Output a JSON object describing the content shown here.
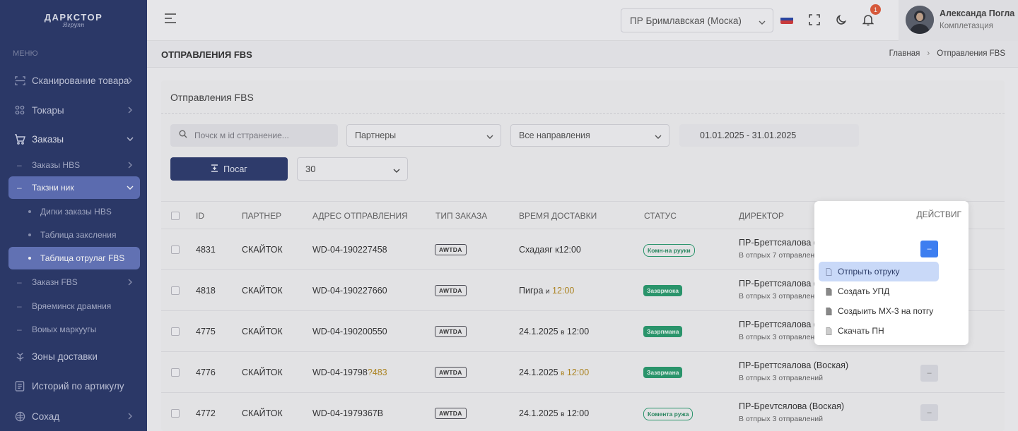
{
  "sidebar": {
    "logo_title": "ДАРКСТОР",
    "logo_sign": "Ягрупп",
    "menu_caption": "МЕНЮ",
    "items": [
      {
        "label": "Сканирование товара",
        "icon": "scan-icon"
      },
      {
        "label": "Токары",
        "icon": "grid-icon"
      },
      {
        "label": "Заказы",
        "icon": "cart-icon"
      },
      {
        "label": "Заказы HBS"
      },
      {
        "label": "Такзни ник"
      },
      {
        "label": "Дигки заказы HBS"
      },
      {
        "label": "Таблица заксления"
      },
      {
        "label": "Таблица отрулаг FBS"
      },
      {
        "label": "Заказн FBS"
      },
      {
        "label": "Вряеминск драмния"
      },
      {
        "label": "Воиых маркуугы"
      },
      {
        "label": "Зоны доставки",
        "icon": "delivery-icon"
      },
      {
        "label": "Историй по артикулу",
        "icon": "history-icon"
      },
      {
        "label": "Сохад",
        "icon": "box-icon"
      }
    ]
  },
  "header": {
    "branch": "ПР Бримлавская (Моска)",
    "notifications_count": "1",
    "user_name": "Александа Погла",
    "user_role": "Комплетазция"
  },
  "page": {
    "title": "ОТПРАВЛЕНИЯ FBS",
    "breadcrumb_home": "Главная",
    "breadcrumb_current": "Отправления FBS"
  },
  "card": {
    "title": "Отправления FBS",
    "search_placeholder": "Почск м id сттранение...",
    "partners": "Партнеры",
    "directions": "Все направления",
    "date_range": "01.01.2025 - 31.01.2025",
    "search_button": "Посаг",
    "per_page": "30"
  },
  "table": {
    "headers": {
      "id": "ID",
      "partner": "ПАРТНЕР",
      "address": "АДРЕС ОТПРАВЛЕНИЯ",
      "order_type": "ТИП ЗАКАЗА",
      "delivery_time": "ВРЕМЯ ДОСТАВКИ",
      "status": "СТАТУС",
      "director": "ДИРЕКТОР"
    },
    "rows": [
      {
        "id": "4831",
        "partner": "СКАЙТОК",
        "address": "WD-04-190227458",
        "address_tail": "",
        "type": "AWTDA",
        "time_main": "Схадаяг к12:00",
        "time_small": "",
        "time_hl": "",
        "status": "Комн-на рууки",
        "status_style": "outline",
        "director": "ПР-Бреттсяалова (Воскла)",
        "sub": "В отпрых 7 отправлений"
      },
      {
        "id": "4818",
        "partner": "СКАЙТОК",
        "address": "WD-04-190227660",
        "address_tail": "",
        "type": "AWTDA",
        "time_main": "Пигра",
        "time_small": "и",
        "time_hl": "12:00",
        "status": "Зазврмока",
        "status_style": "filled",
        "director": "ПР-Бреттсяалова (Вос",
        "sub": "В отпрых 3 отправлений"
      },
      {
        "id": "4775",
        "partner": "СКАЙТОК",
        "address": "WD-04-190200550",
        "address_tail": "",
        "type": "AWTDA",
        "time_main": "24.1.2025",
        "time_small": "в",
        "time_hl": "12:00",
        "status": "Зазрпмана",
        "status_style": "filled",
        "director": "ПР-Бреттсяалова (Вос",
        "sub": "В отпрых 3 отправлен"
      },
      {
        "id": "4776",
        "partner": "СКАЙТОК",
        "address": "WD-04-19798",
        "address_tail": "?483",
        "type": "AWTDA",
        "time_main": "24.1.2025",
        "time_small": "в",
        "time_hl": "12:00",
        "status": "Зазврмана",
        "status_style": "filled",
        "director": "ПР-Бреттсяалова (Воская)",
        "sub": "В отпрых 3 отправлений"
      },
      {
        "id": "4772",
        "partner": "СКАЙТОК",
        "address": "WD-04-1979367B",
        "address_tail": "",
        "type": "AWTDA",
        "time_main": "24.1.2025",
        "time_small": "в",
        "time_hl": "12:00",
        "status": "Комента ружа",
        "status_style": "outline",
        "director": "ПР-Бреvтсялова (Воская)",
        "sub": "В отпрых 3 отправлений"
      }
    ]
  },
  "popover": {
    "header": "ДЕЙСТВИГ",
    "items": [
      "Отпрыть отруку",
      "Создать УПД",
      "Создыить МХ-3 на потгу",
      "Скачать ПН"
    ]
  },
  "colors": {
    "sidebar": "#2c3a6b",
    "active_item": "#5f70b8",
    "primary_button": "#2f3d6f",
    "action_blue": "#3d7ef0",
    "status_green": "#2a9d6f",
    "badge": "#e35d3c",
    "highlight_time": "#b58a20"
  }
}
